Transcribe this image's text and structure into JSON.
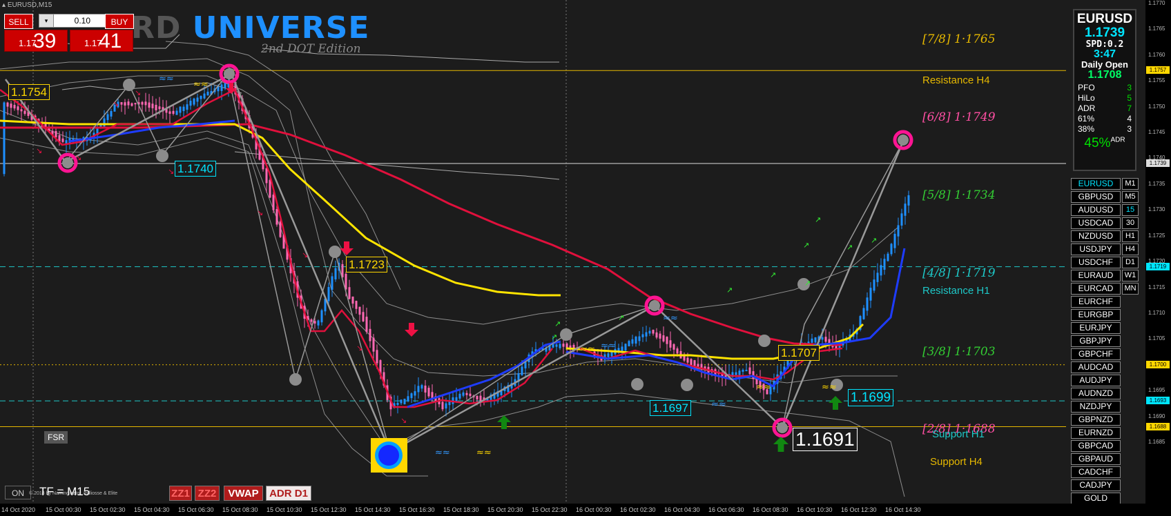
{
  "window_title": "EURUSD,M15",
  "trade_panel": {
    "sell_label": "SELL",
    "buy_label": "BUY",
    "lot_value": "0.10",
    "spinner_glyph": "▾",
    "bid_small": "1.17",
    "bid_big": "39",
    "ask_small": "1.17",
    "ask_big": "41"
  },
  "watermark": {
    "prefix": "RD",
    "main": "UNIVERSE",
    "subtitle": "2nd DOT Edition"
  },
  "info_panel": {
    "symbol": "EURUSD",
    "price": "1.1739",
    "spread": "SPD:0.2",
    "timer": "3:47",
    "daily_open_label": "Daily Open",
    "daily_open_value": "1.1708",
    "stats": [
      {
        "label": "PFO",
        "value": "3"
      },
      {
        "label": "HiLo",
        "value": "5"
      },
      {
        "label": "ADR",
        "value": "7"
      },
      {
        "label": "61%",
        "value": "4"
      },
      {
        "label": "38%",
        "value": "3"
      }
    ],
    "adr_pct": "45%",
    "adr_suffix": "ADR"
  },
  "symbols": [
    "EURUSD",
    "GBPUSD",
    "AUDUSD",
    "USDCAD",
    "NZDUSD",
    "USDJPY",
    "USDCHF",
    "EURAUD",
    "EURCAD",
    "EURCHF",
    "EURGBP",
    "EURJPY",
    "GBPJPY",
    "GBPCHF",
    "AUDCAD",
    "AUDJPY",
    "AUDNZD",
    "NZDJPY",
    "GBPNZD",
    "EURNZD",
    "GBPCAD",
    "GBPAUD",
    "CADCHF",
    "CADJPY",
    "GOLD"
  ],
  "active_symbol": "EURUSD",
  "timeframes": [
    "M1",
    "M5",
    "15",
    "30",
    "H1",
    "H4",
    "D1",
    "W1",
    "MN"
  ],
  "active_timeframe": "15",
  "y_axis": {
    "ticks": [
      "1.1770",
      "1.1765",
      "1.1760",
      "1.1755",
      "1.1750",
      "1.1745",
      "1.1740",
      "1.1735",
      "1.1730",
      "1.1725",
      "1.1720",
      "1.1715",
      "1.1710",
      "1.1705",
      "1.1700",
      "1.1695",
      "1.1690",
      "1.1685"
    ],
    "tags": [
      {
        "text": "1.1757",
        "color": "#ffd700"
      },
      {
        "text": "1.1739",
        "color": "#dddddd"
      },
      {
        "text": "1.1719",
        "color": "#00e5ff"
      },
      {
        "text": "1.1700",
        "color": "#ffd700"
      },
      {
        "text": "1.1693",
        "color": "#00e5ff"
      },
      {
        "text": "1.1688",
        "color": "#ffd700"
      }
    ]
  },
  "x_axis": [
    "14 Oct 2020",
    "15 Oct 00:30",
    "15 Oct 02:30",
    "15 Oct 04:30",
    "15 Oct 06:30",
    "15 Oct 08:30",
    "15 Oct 10:30",
    "15 Oct 12:30",
    "15 Oct 14:30",
    "15 Oct 16:30",
    "15 Oct 18:30",
    "15 Oct 20:30",
    "15 Oct 22:30",
    "16 Oct 00:30",
    "16 Oct 02:30",
    "16 Oct 04:30",
    "16 Oct 06:30",
    "16 Oct 08:30",
    "16 Oct 10:30",
    "16 Oct 12:30",
    "16 Oct 14:30"
  ],
  "murrey_levels": [
    {
      "text": "[7/8]  1·1765",
      "color": "#e6b800"
    },
    {
      "text": "[6/8]  1·1749",
      "color": "#ff4fa3"
    },
    {
      "text": "[5/8]  1·1734",
      "color": "#33cc33"
    },
    {
      "text": "[4/8]  1·1719",
      "color": "#1ec8c8"
    },
    {
      "text": "[3/8]  1·1703",
      "color": "#33cc33"
    },
    {
      "text": "[2/8]  1·1688",
      "color": "#ff4fa3"
    }
  ],
  "sr_labels": [
    {
      "text": "Resistance H4",
      "color": "#e6b800"
    },
    {
      "text": "Resistance H1",
      "color": "#1ec8c8"
    },
    {
      "text": "Support H1",
      "color": "#1ec8c8"
    },
    {
      "text": "Support H4",
      "color": "#e6b800"
    }
  ],
  "price_labels": [
    {
      "text": "1.1754",
      "color": "#ffd700"
    },
    {
      "text": "1.1740",
      "color": "#00e5ff"
    },
    {
      "text": "1.1723",
      "color": "#ffd700"
    },
    {
      "text": "1.1697",
      "color": "#00e5ff"
    },
    {
      "text": "1.1707",
      "color": "#ffd700"
    },
    {
      "text": "1.1699",
      "color": "#00e5ff"
    },
    {
      "text": "1.1691",
      "color": "#ffffff"
    }
  ],
  "bottom_buttons": [
    {
      "label": "ZZ1",
      "bg": "#b01c1c",
      "fg": "#ff6666"
    },
    {
      "label": "ZZ2",
      "bg": "#b01c1c",
      "fg": "#ff6666"
    },
    {
      "label": "VWAP",
      "bg": "#b01c1c",
      "fg": "#ffffff"
    },
    {
      "label": "ADR D1",
      "bg": "#f0e8e8",
      "fg": "#b01c1c"
    }
  ],
  "fsr_label": "FSR",
  "on_label": "ON",
  "tf_label": "TF = M15",
  "copyright": "© 2018 by Naminginator, milliosse & Elite",
  "colors": {
    "background": "#1c1c1c",
    "bull_candle": "#1e90ff",
    "bear_candle": "#ff69b4",
    "ma_red": "#e0103c",
    "ma_yellow": "#ffe400",
    "ma_blue": "#1e3cff",
    "envelope": "#aaaaaa",
    "zigzag": "#999999",
    "pivot_ring": "#ff1493"
  }
}
